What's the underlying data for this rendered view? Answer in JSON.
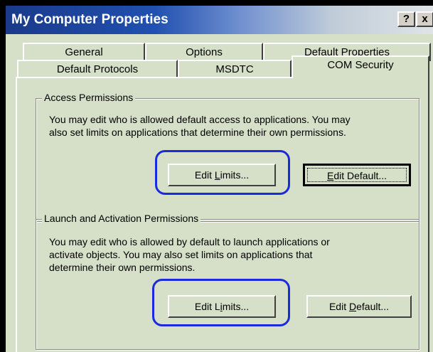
{
  "window": {
    "title": "My Computer Properties",
    "help_label": "?",
    "close_label": "x"
  },
  "tabs": {
    "row_back": [
      {
        "label": "General"
      },
      {
        "label": "Options"
      },
      {
        "label": "Default Properties"
      }
    ],
    "row_front": [
      {
        "label": "Default Protocols"
      },
      {
        "label": "MSDTC"
      },
      {
        "label": "COM Security",
        "active": true
      }
    ]
  },
  "access_permissions": {
    "legend": "Access Permissions",
    "description_line1": "You may edit who is allowed default access to applications. You may",
    "description_line2": "also set limits on applications that determine their own permissions.",
    "edit_limits": {
      "pre": "Edit ",
      "accel": "L",
      "post": "imits..."
    },
    "edit_default": {
      "pre": "",
      "accel": "E",
      "post": "dit Default..."
    }
  },
  "launch_permissions": {
    "legend": "Launch and Activation Permissions",
    "description_line1": "You may edit who is allowed by default to launch applications or",
    "description_line2": "activate objects. You may also set limits on applications that",
    "description_line3": "determine their own permissions.",
    "edit_limits": {
      "pre": "Edit L",
      "accel": "i",
      "post": "mits..."
    },
    "edit_default": {
      "pre": "Edit ",
      "accel": "D",
      "post": "efault..."
    }
  },
  "colors": {
    "dialog_background": "#d6dfc8",
    "annotation_blue": "#1a2adc",
    "titlebar_start": "#1a3a8a"
  }
}
